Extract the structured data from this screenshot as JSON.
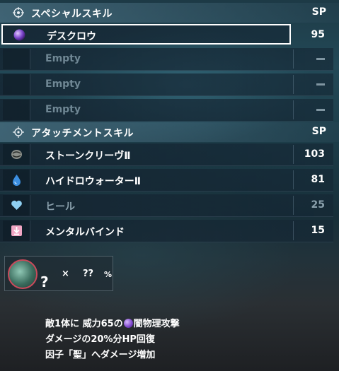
{
  "special_section": {
    "title": "スペシャルスキル",
    "sp_label": "SP",
    "icon": "compass-star-icon",
    "items": [
      {
        "name": "デスクロウ",
        "cost": "95",
        "icon": "dark-orb-icon",
        "state": "selected"
      },
      {
        "name": "Empty",
        "cost": "",
        "icon": "",
        "state": "empty"
      },
      {
        "name": "Empty",
        "cost": "",
        "icon": "",
        "state": "empty"
      },
      {
        "name": "Empty",
        "cost": "",
        "icon": "",
        "state": "empty"
      }
    ]
  },
  "attach_section": {
    "title": "アタッチメントスキル",
    "sp_label": "SP",
    "icon": "target-icon",
    "items": [
      {
        "name": "ストーンクリーヴⅡ",
        "cost": "103",
        "icon": "stone-icon",
        "state": "normal"
      },
      {
        "name": "ハイドロウォーターⅡ",
        "cost": "81",
        "icon": "water-drop-icon",
        "state": "normal"
      },
      {
        "name": "ヒール",
        "cost": "25",
        "icon": "heart-icon",
        "state": "dim"
      },
      {
        "name": "メンタルバインド",
        "cost": "15",
        "icon": "bind-arrow-icon",
        "state": "normal"
      }
    ]
  },
  "drop": {
    "unknown_mark": "?",
    "multiplier": "×",
    "amount": "??",
    "percent": "%"
  },
  "description": {
    "line1_prefix": "敵1体に 威力65の",
    "line1_suffix": "闇物理攻撃",
    "line2": "ダメージの20%分HP回復",
    "line3": "因子「聖」へダメージ増加"
  }
}
